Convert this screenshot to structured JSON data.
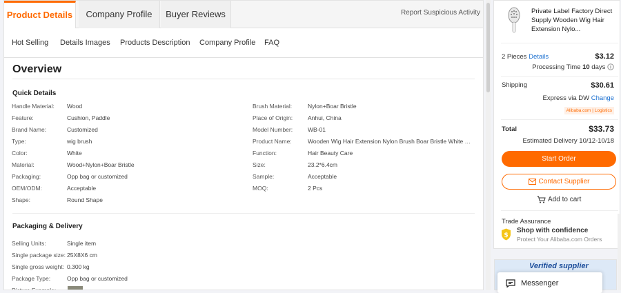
{
  "tabs": [
    "Product Details",
    "Company Profile",
    "Buyer Reviews"
  ],
  "report_link": "Report Suspicious Activity",
  "subnav": [
    "Hot Selling",
    "Details Images",
    "Products Description",
    "Company Profile",
    "FAQ"
  ],
  "overview_title": "Overview",
  "quick_details": {
    "title": "Quick Details",
    "left": [
      {
        "k": "Handle Material:",
        "v": "Wood"
      },
      {
        "k": "Feature:",
        "v": "Cushion, Paddle"
      },
      {
        "k": "Brand Name:",
        "v": "Customized"
      },
      {
        "k": "Type:",
        "v": "wig brush"
      },
      {
        "k": "Color:",
        "v": "White"
      },
      {
        "k": "Material:",
        "v": "Wood+Nylon+Boar Bristle"
      },
      {
        "k": "Packaging:",
        "v": "Opp bag or customized"
      },
      {
        "k": "OEM/ODM:",
        "v": "Acceptable"
      },
      {
        "k": "Shape:",
        "v": "Round Shape"
      }
    ],
    "right": [
      {
        "k": "Brush Material:",
        "v": "Nylon+Boar Bristle"
      },
      {
        "k": "Place of Origin:",
        "v": "Anhui, China"
      },
      {
        "k": "Model Number:",
        "v": "WB-01"
      },
      {
        "k": "Product Name:",
        "v": "Wooden Wig Hair Extension Nylon Brush Boar Bristle White Br..."
      },
      {
        "k": "Function:",
        "v": "Hair Beauty Care"
      },
      {
        "k": "Size:",
        "v": "23.2*6.4cm"
      },
      {
        "k": "Sample:",
        "v": "Acceptable"
      },
      {
        "k": "MOQ:",
        "v": "2 Pcs"
      }
    ]
  },
  "packaging": {
    "title": "Packaging & Delivery",
    "rows": [
      {
        "k": "Selling Units:",
        "v": "Single item"
      },
      {
        "k": "Single package size:",
        "v": "25X8X6 cm"
      },
      {
        "k": "Single gross weight:",
        "v": "0.300 kg"
      },
      {
        "k": "Package Type:",
        "v": "Opp bag or customized"
      },
      {
        "k": "Picture Example:",
        "v": ""
      }
    ]
  },
  "side": {
    "product_title": "Private Label Factory Direct Supply Wooden Wig Hair Extension Nylo...",
    "qty_text": "2 Pieces",
    "details_link": "Details",
    "unit_price": "$3.12",
    "processing_label": "Processing Time",
    "processing_days": "10",
    "processing_unit": "days",
    "shipping_label": "Shipping",
    "shipping_price": "$30.61",
    "express_text": "Express via DW",
    "change_link": "Change",
    "logistics_badge": "Alibaba.com | Logistics",
    "total_label": "Total",
    "total_price": "$33.73",
    "delivery_text": "Estimated Delivery 10/12-10/18",
    "start_order": "Start Order",
    "contact_supplier": "Contact Supplier",
    "add_to_cart": "Add to cart",
    "trade_assurance": "Trade Assurance",
    "shop_confidence": "Shop with confidence",
    "protect_text": "Protect Your Alibaba.com Orders"
  },
  "verified_supplier": "Verified supplier",
  "messenger": "Messenger",
  "colors": {
    "accent": "#ff6a00",
    "link": "#1a6fd0"
  }
}
